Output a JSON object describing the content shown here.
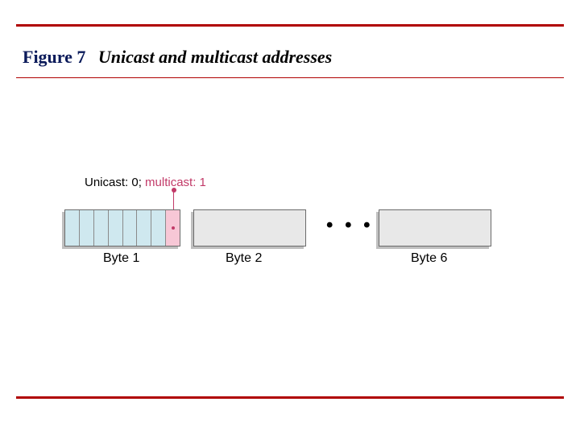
{
  "figure": {
    "label": "Figure 7",
    "title": "Unicast and multicast addresses"
  },
  "annotation": {
    "unicast": "Unicast: 0; ",
    "multicast": "multicast: 1"
  },
  "bytes": {
    "b1": "Byte 1",
    "b2": "Byte 2",
    "b6": "Byte 6",
    "ellipsis": "• • •"
  }
}
